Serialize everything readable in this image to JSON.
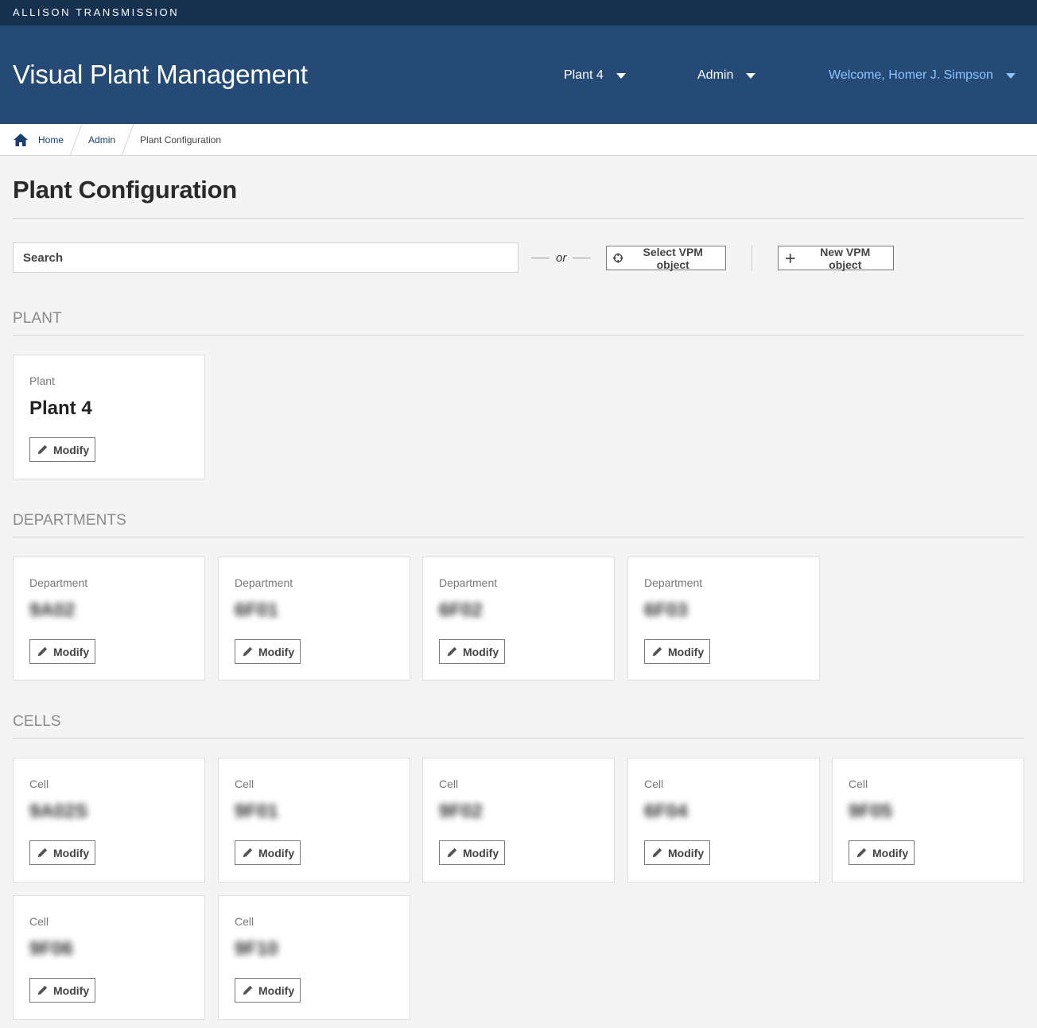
{
  "brand": "ALLISON TRANSMISSION",
  "header": {
    "app_title": "Visual Plant Management",
    "plant_menu": "Plant 4",
    "admin_menu": "Admin",
    "welcome_menu": "Welcome, Homer J. Simpson"
  },
  "breadcrumb": {
    "home": "Home",
    "admin": "Admin",
    "current": "Plant Configuration"
  },
  "page_title": "Plant Configuration",
  "toolbar": {
    "search_placeholder": "Search",
    "or_text": "or",
    "select_label": "Select VPM object",
    "new_label": "New VPM object"
  },
  "sections": {
    "plant": "PLANT",
    "departments": "DEPARTMENTS",
    "cells": "CELLS"
  },
  "modify_label": "Modify",
  "plant": {
    "type": "Plant",
    "name": "Plant 4"
  },
  "departments": [
    {
      "type": "Department",
      "name": "9A02"
    },
    {
      "type": "Department",
      "name": "6F01"
    },
    {
      "type": "Department",
      "name": "6F02"
    },
    {
      "type": "Department",
      "name": "6F03"
    }
  ],
  "cells": [
    {
      "type": "Cell",
      "name": "9A02S"
    },
    {
      "type": "Cell",
      "name": "9F01"
    },
    {
      "type": "Cell",
      "name": "9F02"
    },
    {
      "type": "Cell",
      "name": "6F04"
    },
    {
      "type": "Cell",
      "name": "9F05"
    },
    {
      "type": "Cell",
      "name": "9F06"
    },
    {
      "type": "Cell",
      "name": "9F10"
    }
  ],
  "colors": {
    "topstrip": "#16304f",
    "header": "#244a75",
    "welcome": "#8ec5ff",
    "link": "#1a3f6e"
  },
  "icons": {
    "home": "home-icon",
    "select": "crosshair-icon",
    "new": "plus-icon",
    "modify": "pencil-icon",
    "dropdown": "caret-down-icon"
  }
}
